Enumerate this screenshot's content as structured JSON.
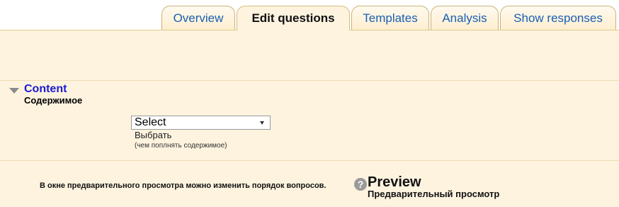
{
  "tabs": [
    {
      "label": "Overview",
      "active": false
    },
    {
      "label": "Edit questions",
      "active": true
    },
    {
      "label": "Templates",
      "active": false
    },
    {
      "label": "Analysis",
      "active": false
    },
    {
      "label": "Show responses",
      "active": false
    }
  ],
  "content": {
    "title": "Content",
    "subtitle": "Содержимое",
    "select": {
      "value": "Select",
      "translation": "Выбрать",
      "note": "(чем поплнять содержимое)"
    }
  },
  "preview": {
    "reorder_text": "В окне предварительного просмотра можно изменить порядок вопросов.",
    "help_glyph": "?",
    "title": "Preview",
    "subtitle": "Предварительный просмотр"
  },
  "colors": {
    "page_bg": "#fdf3df",
    "link": "#1a5fb4",
    "section_title": "#1b1bd6"
  },
  "icons": {
    "section_toggle": "caret-down-icon",
    "help": "help-icon",
    "select_arrow": "chevron-down-icon"
  }
}
